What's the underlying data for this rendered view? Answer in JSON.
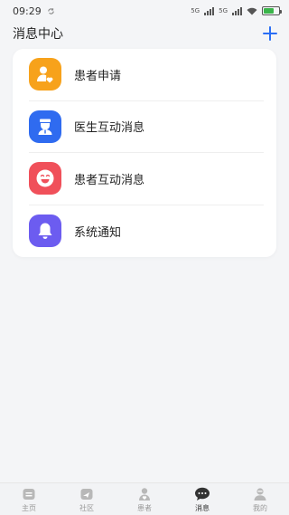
{
  "status_bar": {
    "time": "09:29",
    "signal_1_label": "5G",
    "signal_2_label": "5G"
  },
  "header": {
    "title": "消息中心"
  },
  "messages": [
    {
      "label": "患者申请",
      "color": "#f7a21b",
      "icon": "patient-request-icon"
    },
    {
      "label": "医生互动消息",
      "color": "#2f6bf0",
      "icon": "doctor-icon"
    },
    {
      "label": "患者互动消息",
      "color": "#f0505a",
      "icon": "smile-face-icon"
    },
    {
      "label": "系统通知",
      "color": "#6c5cf0",
      "icon": "bell-icon"
    }
  ],
  "tab_bar": {
    "tabs": [
      {
        "label": "主页",
        "icon": "home-icon"
      },
      {
        "label": "社区",
        "icon": "community-icon"
      },
      {
        "label": "患者",
        "icon": "patient-icon"
      },
      {
        "label": "消息",
        "icon": "chat-icon",
        "active": true
      },
      {
        "label": "我的",
        "icon": "profile-icon"
      }
    ]
  },
  "colors": {
    "accent": "#2a6ef5",
    "background": "#f4f5f7"
  }
}
